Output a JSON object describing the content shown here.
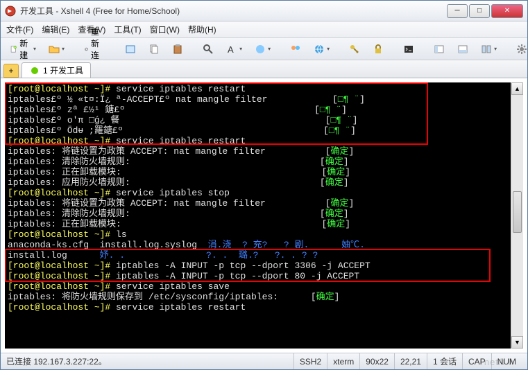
{
  "titlebar": {
    "title": "开发工具 - Xshell 4 (Free for Home/School)"
  },
  "menu": {
    "file": "文件(F)",
    "edit": "编辑(E)",
    "view": "查看(V)",
    "tools": "工具(T)",
    "window": "窗口(W)",
    "help": "帮助(H)"
  },
  "toolbar": {
    "new": "新建",
    "reconnect": "重新连接"
  },
  "tabs": {
    "active": "1 开发工具"
  },
  "terminal": {
    "prompt": "[root@localhost ~]#",
    "lines": {
      "l1_cmd": "service iptables restart",
      "l2": "iptables£º ½ «t¤:Ï¿ ª-ACCEPT£º nat mangle filter",
      "l2_ok": "□¶ ¨",
      "l3": "iptables£º zª £½¹ 鎕£º",
      "l3_ok": "□¶ ¨",
      "l4": "iptables£º oʹπ □ǵ¿ 餐",
      "l4_ok": "□¶ ¨",
      "l5": "iptables£º Ödᵾ ;羅鎕£º",
      "l5_ok": "□¶ ¨",
      "l6_cmd": "service iptables restart",
      "l7": "iptables: 将链设置为政策 ACCEPT: nat mangle filter",
      "ok": "确定",
      "l8": "iptables: 清除防火墙规则:",
      "l9": "iptables: 正在卸载模块:",
      "l10": "iptables: 应用防火墙规则:",
      "l11_cmd": "service iptables stop",
      "l12": "iptables: 将链设置为政策 ACCEPT: nat mangle filter",
      "l13": "iptables: 清除防火墙规则:",
      "l14": "iptables: 正在卸载模块:",
      "l15_cmd": "ls",
      "l16a": "anaconda-ks.cfg  install.log.syslog  ",
      "l16b": "涓.浇  ? 充?   ? 剧.      妯℃.",
      "l17a": "install.log      ",
      "l17b": "妤. .               ?. .  璐.?   ?. . ? ?",
      "l18_cmd": "iptables -A INPUT -p tcp --dport 3306 -j ACCEPT",
      "l19_cmd": "iptables -A INPUT -p tcp --dport 80 -j ACCEPT",
      "l20_cmd": "service iptables save",
      "l21": "iptables: 将防火墙规则保存到 /etc/sysconfig/iptables:",
      "l22_cmd": "service iptables restart"
    }
  },
  "status": {
    "connected": "已连接 192.167.3.227:22。",
    "ssh": "SSH2",
    "term": "xterm",
    "size": "90x22",
    "cursor": "22,21",
    "sessions": "1 会话",
    "cap": "CAP",
    "num": "NUM"
  },
  "watermark": "net/t       h"
}
